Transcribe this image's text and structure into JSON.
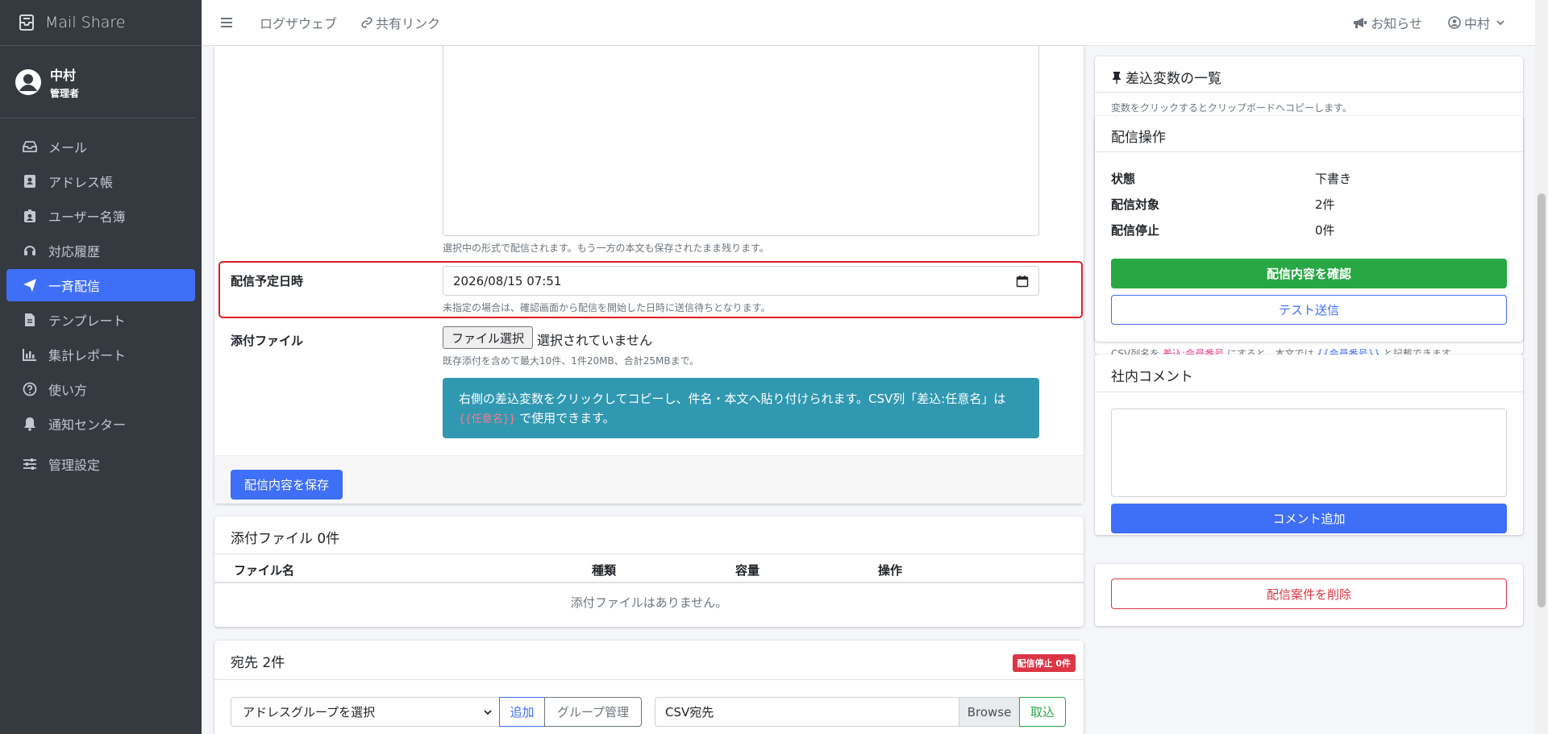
{
  "app": {
    "name": "Mail Share"
  },
  "user": {
    "name": "中村",
    "role": "管理者"
  },
  "sidebar": {
    "items": [
      {
        "label": "メール",
        "icon": "inbox-icon"
      },
      {
        "label": "アドレス帳",
        "icon": "address-book-icon"
      },
      {
        "label": "ユーザー名簿",
        "icon": "id-badge-icon"
      },
      {
        "label": "対応履歴",
        "icon": "headset-icon"
      },
      {
        "label": "一斉配信",
        "icon": "paper-plane-icon"
      },
      {
        "label": "テンプレート",
        "icon": "file-icon"
      },
      {
        "label": "集計レポート",
        "icon": "chart-bar-icon"
      },
      {
        "label": "使い方",
        "icon": "question-circle-icon"
      },
      {
        "label": "通知センター",
        "icon": "bell-icon"
      },
      {
        "label": "管理設定",
        "icon": "sliders-icon"
      }
    ],
    "active_index": 4
  },
  "topbar": {
    "link1": "ログザウェブ",
    "link2": "共有リンク",
    "notice": "お知らせ",
    "user": "中村"
  },
  "form": {
    "body_help": "選択中の形式で配信されます。もう一方の本文も保存されたまま残ります。",
    "schedule_label": "配信予定日時",
    "schedule_value": "2026/08/15 07:51",
    "schedule_help": "未指定の場合は、確認画面から配信を開始した日時に送信待ちとなります。",
    "attach_label": "添付ファイル",
    "file_button": "ファイル選択",
    "file_status": "選択されていません",
    "attach_help": "既存添付を含めて最大10件、1件20MB、合計25MBまで。",
    "info_text": "右側の差込変数をクリックしてコピーし、件名・本文へ貼り付けられます。CSV列「差込:任意名」は",
    "info_code": "{{任意名}}",
    "info_suffix": "で使用できます。",
    "save_button": "配信内容を保存"
  },
  "attachments": {
    "title": "添付ファイル 0件",
    "columns": [
      "ファイル名",
      "種類",
      "容量",
      "操作"
    ],
    "empty": "添付ファイルはありません。"
  },
  "recipients": {
    "title": "宛先 2件",
    "badge": "配信停止 0件",
    "group_select": "アドレスグループを選択",
    "add_button": "追加",
    "group_manage_button": "グループ管理",
    "csv_placeholder": "CSV宛先",
    "browse": "Browse",
    "import_button": "取込"
  },
  "variables": {
    "title": "差込変数の一覧",
    "subtitle": "変数をクリックするとクリップボードへコピーします。",
    "peek_prefix": "CSV列名を",
    "peek_code": "差込:会員番号",
    "peek_mid": "にすると、本文では",
    "peek_code2": "{{会員番号}}",
    "peek_suffix": "と記載できます。"
  },
  "distribution": {
    "title": "配信操作",
    "rows": [
      {
        "key": "状態",
        "value": "下書き"
      },
      {
        "key": "配信対象",
        "value": "2件"
      },
      {
        "key": "配信停止",
        "value": "0件"
      }
    ],
    "confirm_button": "配信内容を確認",
    "test_button": "テスト送信"
  },
  "comments": {
    "title": "社内コメント",
    "add_button": "コメント追加"
  },
  "danger": {
    "delete_button": "配信案件を削除"
  },
  "colors": {
    "sidebar_bg": "#343a40",
    "primary": "#3f6ff7",
    "success": "#28a745",
    "danger": "#dc3545",
    "info": "#3098b1"
  }
}
